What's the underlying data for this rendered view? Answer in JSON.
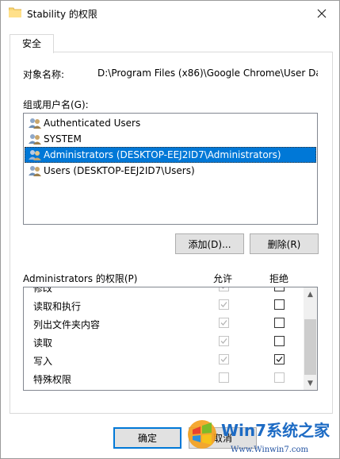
{
  "window": {
    "title": "Stability 的权限"
  },
  "tabs": [
    {
      "label": "安全"
    }
  ],
  "object": {
    "label": "对象名称:",
    "value": "D:\\Program Files (x86)\\Google Chrome\\User Da"
  },
  "groups": {
    "label": "组或用户名(G):",
    "items": [
      {
        "label": "Authenticated Users",
        "selected": false
      },
      {
        "label": "SYSTEM",
        "selected": false
      },
      {
        "label": "Administrators (DESKTOP-EEJ2ID7\\Administrators)",
        "selected": true
      },
      {
        "label": "Users (DESKTOP-EEJ2ID7\\Users)",
        "selected": false
      }
    ]
  },
  "buttons": {
    "add": "添加(D)...",
    "remove": "删除(R)",
    "ok": "确定",
    "cancel": "取消"
  },
  "permissions": {
    "header": "Administrators 的权限(P)",
    "allow_header": "允许",
    "deny_header": "拒绝",
    "rows": [
      {
        "name": "修改",
        "allow": true,
        "allow_disabled": true,
        "deny": false,
        "deny_disabled": false
      },
      {
        "name": "读取和执行",
        "allow": true,
        "allow_disabled": true,
        "deny": false,
        "deny_disabled": false
      },
      {
        "name": "列出文件夹内容",
        "allow": true,
        "allow_disabled": true,
        "deny": false,
        "deny_disabled": false
      },
      {
        "name": "读取",
        "allow": true,
        "allow_disabled": true,
        "deny": false,
        "deny_disabled": false
      },
      {
        "name": "写入",
        "allow": true,
        "allow_disabled": true,
        "deny": true,
        "deny_disabled": false
      },
      {
        "name": "特殊权限",
        "allow": false,
        "allow_disabled": true,
        "deny": false,
        "deny_disabled": true
      }
    ]
  },
  "watermark": {
    "brand": "Win7系统之家",
    "site": "Www.Winwin7.com"
  },
  "colors": {
    "selection": "#0078d7",
    "button_face": "#e1e1e1"
  }
}
